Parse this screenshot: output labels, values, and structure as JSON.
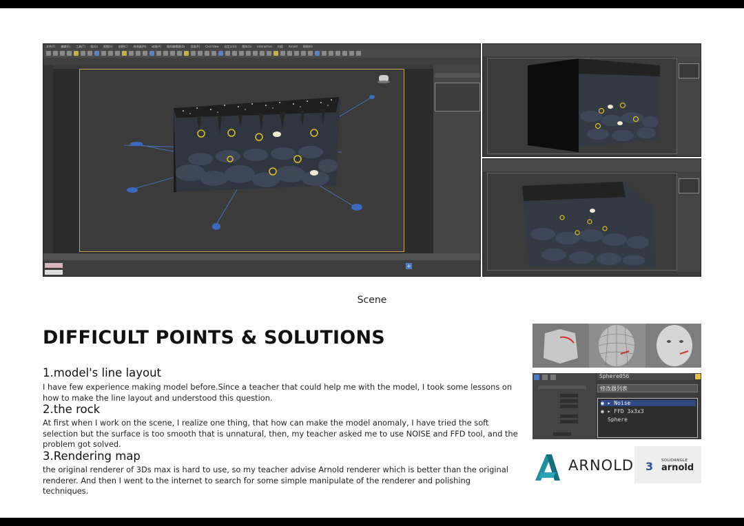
{
  "caption": "Scene",
  "heading": "DIFFICULT POINTS & SOLUTIONS",
  "sections": [
    {
      "title": "1.model's line layout",
      "body": "I have few experience making model before.Since a teacher that could help me with the model, I took some lessons on how to make the line layout and understood this question."
    },
    {
      "title": "2.the rock",
      "body": "At first when I work on the scene, I realize one thing, that how can make the model anomaly, I have tried the soft selection but the surface is too smooth that is unnatural, then, my teacher asked me to use NOISE and FFD tool, and the problem got solved."
    },
    {
      "title": "3.Rendering map",
      "body": "the original renderer of 3Ds max is hard to use, so my teacher advise Arnold renderer which is better than the original renderer. And then I went to the internet to search for some simple manipulate of the renderer and polishing techniques."
    }
  ],
  "screenshot": {
    "menu": [
      "文件(F)",
      "编辑(E)",
      "工具(T)",
      "组(G)",
      "视图(V)",
      "创建(C)",
      "修改器(M)",
      "动画(A)",
      "图形编辑器(D)",
      "渲染(R)",
      "Civil View",
      "自定义(U)",
      "脚本(S)",
      "Interactive",
      "内容",
      "Arnold",
      "帮助(H)"
    ]
  },
  "modifier_panel": {
    "object_name": "Sphere056",
    "dropdown_label": "修改器列表",
    "stack": [
      "Noise",
      "FFD 3x3x3",
      "Sphere"
    ]
  },
  "logos": {
    "arnold": "ARNOLD",
    "solid_number": "3",
    "solid_small": "SOLIDANGLE",
    "solid_big": "arnold"
  },
  "colors": {
    "accent_blue": "#2f4a83",
    "arnold_teal": "#1e8fa0",
    "viewport_gold": "#c9a64a"
  }
}
